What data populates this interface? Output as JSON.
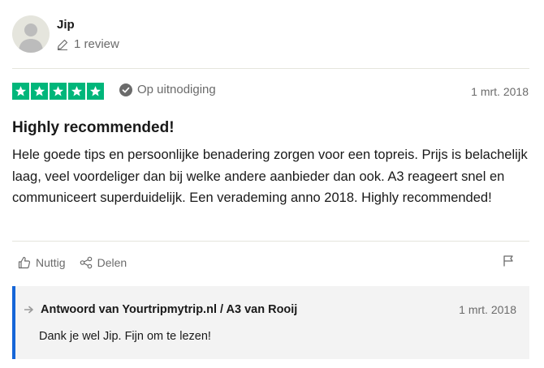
{
  "reviewer": {
    "name": "Jip",
    "review_count": "1 review",
    "avatar_icon": "user-silhouette-icon"
  },
  "review": {
    "rating": 5,
    "rating_max": 5,
    "star_color": "#00b67a",
    "invited_label": "Op uitnodiging",
    "date": "1 mrt. 2018",
    "title": "Highly recommended!",
    "body": "Hele goede tips en persoonlijke benadering zorgen voor een topreis. Prijs is belachelijk laag, veel voordeliger dan bij welke andere aanbieder dan ook. A3 reageert snel en communiceert superduidelijk. Een verademing anno 2018. Highly recommended!"
  },
  "actions": {
    "useful_label": "Nuttig",
    "share_label": "Delen",
    "useful_icon": "thumbs-up-icon",
    "share_icon": "share-icon",
    "report_icon": "flag-icon"
  },
  "reply": {
    "heading": "Antwoord van Yourtripmytrip.nl / A3 van Rooij",
    "date": "1 mrt. 2018",
    "text": "Dank je wel Jip. Fijn om te lezen!",
    "accent_color": "#1565d8"
  }
}
